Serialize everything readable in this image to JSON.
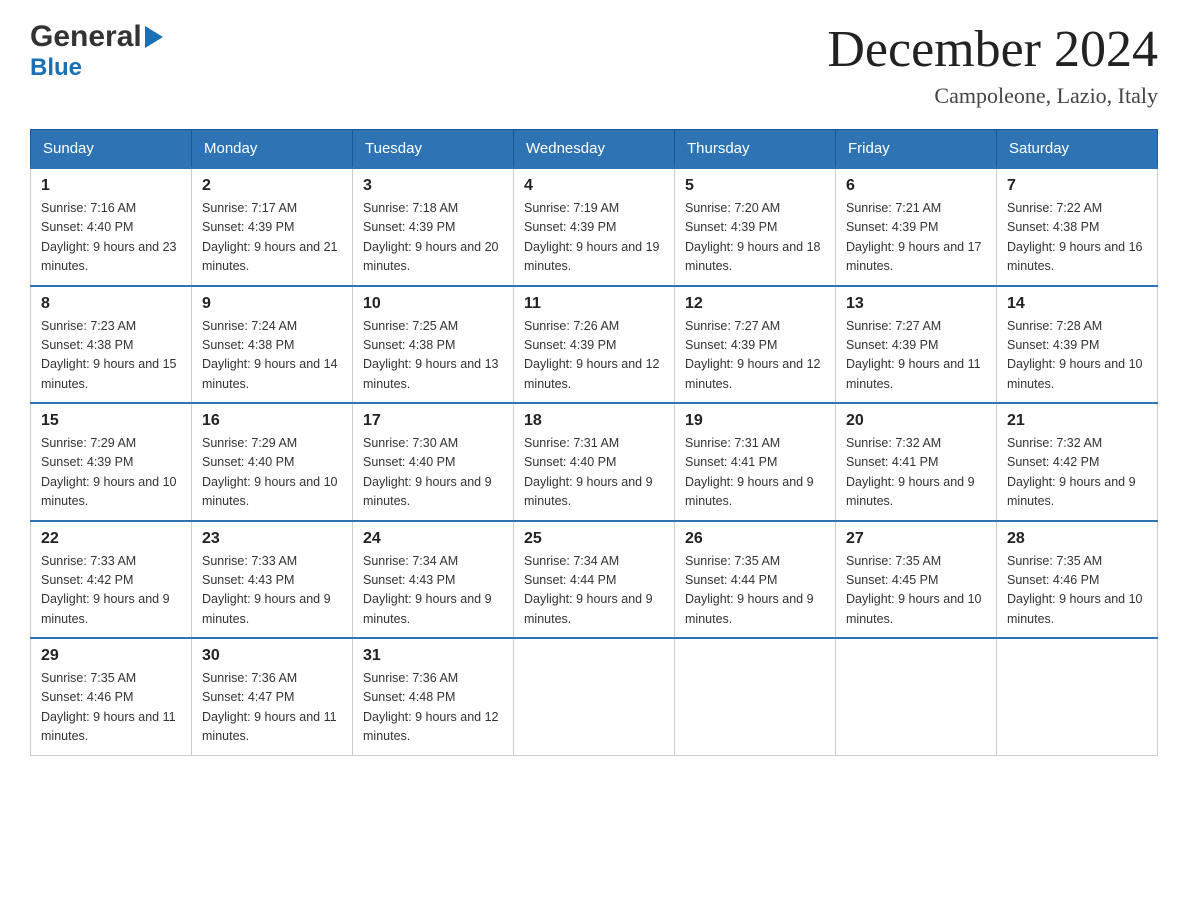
{
  "header": {
    "logo": {
      "general_text": "General",
      "blue_text": "Blue"
    },
    "title": "December 2024",
    "location": "Campoleone, Lazio, Italy"
  },
  "columns": [
    "Sunday",
    "Monday",
    "Tuesday",
    "Wednesday",
    "Thursday",
    "Friday",
    "Saturday"
  ],
  "weeks": [
    [
      {
        "day": "1",
        "sunrise": "Sunrise: 7:16 AM",
        "sunset": "Sunset: 4:40 PM",
        "daylight": "Daylight: 9 hours and 23 minutes."
      },
      {
        "day": "2",
        "sunrise": "Sunrise: 7:17 AM",
        "sunset": "Sunset: 4:39 PM",
        "daylight": "Daylight: 9 hours and 21 minutes."
      },
      {
        "day": "3",
        "sunrise": "Sunrise: 7:18 AM",
        "sunset": "Sunset: 4:39 PM",
        "daylight": "Daylight: 9 hours and 20 minutes."
      },
      {
        "day": "4",
        "sunrise": "Sunrise: 7:19 AM",
        "sunset": "Sunset: 4:39 PM",
        "daylight": "Daylight: 9 hours and 19 minutes."
      },
      {
        "day": "5",
        "sunrise": "Sunrise: 7:20 AM",
        "sunset": "Sunset: 4:39 PM",
        "daylight": "Daylight: 9 hours and 18 minutes."
      },
      {
        "day": "6",
        "sunrise": "Sunrise: 7:21 AM",
        "sunset": "Sunset: 4:39 PM",
        "daylight": "Daylight: 9 hours and 17 minutes."
      },
      {
        "day": "7",
        "sunrise": "Sunrise: 7:22 AM",
        "sunset": "Sunset: 4:38 PM",
        "daylight": "Daylight: 9 hours and 16 minutes."
      }
    ],
    [
      {
        "day": "8",
        "sunrise": "Sunrise: 7:23 AM",
        "sunset": "Sunset: 4:38 PM",
        "daylight": "Daylight: 9 hours and 15 minutes."
      },
      {
        "day": "9",
        "sunrise": "Sunrise: 7:24 AM",
        "sunset": "Sunset: 4:38 PM",
        "daylight": "Daylight: 9 hours and 14 minutes."
      },
      {
        "day": "10",
        "sunrise": "Sunrise: 7:25 AM",
        "sunset": "Sunset: 4:38 PM",
        "daylight": "Daylight: 9 hours and 13 minutes."
      },
      {
        "day": "11",
        "sunrise": "Sunrise: 7:26 AM",
        "sunset": "Sunset: 4:39 PM",
        "daylight": "Daylight: 9 hours and 12 minutes."
      },
      {
        "day": "12",
        "sunrise": "Sunrise: 7:27 AM",
        "sunset": "Sunset: 4:39 PM",
        "daylight": "Daylight: 9 hours and 12 minutes."
      },
      {
        "day": "13",
        "sunrise": "Sunrise: 7:27 AM",
        "sunset": "Sunset: 4:39 PM",
        "daylight": "Daylight: 9 hours and 11 minutes."
      },
      {
        "day": "14",
        "sunrise": "Sunrise: 7:28 AM",
        "sunset": "Sunset: 4:39 PM",
        "daylight": "Daylight: 9 hours and 10 minutes."
      }
    ],
    [
      {
        "day": "15",
        "sunrise": "Sunrise: 7:29 AM",
        "sunset": "Sunset: 4:39 PM",
        "daylight": "Daylight: 9 hours and 10 minutes."
      },
      {
        "day": "16",
        "sunrise": "Sunrise: 7:29 AM",
        "sunset": "Sunset: 4:40 PM",
        "daylight": "Daylight: 9 hours and 10 minutes."
      },
      {
        "day": "17",
        "sunrise": "Sunrise: 7:30 AM",
        "sunset": "Sunset: 4:40 PM",
        "daylight": "Daylight: 9 hours and 9 minutes."
      },
      {
        "day": "18",
        "sunrise": "Sunrise: 7:31 AM",
        "sunset": "Sunset: 4:40 PM",
        "daylight": "Daylight: 9 hours and 9 minutes."
      },
      {
        "day": "19",
        "sunrise": "Sunrise: 7:31 AM",
        "sunset": "Sunset: 4:41 PM",
        "daylight": "Daylight: 9 hours and 9 minutes."
      },
      {
        "day": "20",
        "sunrise": "Sunrise: 7:32 AM",
        "sunset": "Sunset: 4:41 PM",
        "daylight": "Daylight: 9 hours and 9 minutes."
      },
      {
        "day": "21",
        "sunrise": "Sunrise: 7:32 AM",
        "sunset": "Sunset: 4:42 PM",
        "daylight": "Daylight: 9 hours and 9 minutes."
      }
    ],
    [
      {
        "day": "22",
        "sunrise": "Sunrise: 7:33 AM",
        "sunset": "Sunset: 4:42 PM",
        "daylight": "Daylight: 9 hours and 9 minutes."
      },
      {
        "day": "23",
        "sunrise": "Sunrise: 7:33 AM",
        "sunset": "Sunset: 4:43 PM",
        "daylight": "Daylight: 9 hours and 9 minutes."
      },
      {
        "day": "24",
        "sunrise": "Sunrise: 7:34 AM",
        "sunset": "Sunset: 4:43 PM",
        "daylight": "Daylight: 9 hours and 9 minutes."
      },
      {
        "day": "25",
        "sunrise": "Sunrise: 7:34 AM",
        "sunset": "Sunset: 4:44 PM",
        "daylight": "Daylight: 9 hours and 9 minutes."
      },
      {
        "day": "26",
        "sunrise": "Sunrise: 7:35 AM",
        "sunset": "Sunset: 4:44 PM",
        "daylight": "Daylight: 9 hours and 9 minutes."
      },
      {
        "day": "27",
        "sunrise": "Sunrise: 7:35 AM",
        "sunset": "Sunset: 4:45 PM",
        "daylight": "Daylight: 9 hours and 10 minutes."
      },
      {
        "day": "28",
        "sunrise": "Sunrise: 7:35 AM",
        "sunset": "Sunset: 4:46 PM",
        "daylight": "Daylight: 9 hours and 10 minutes."
      }
    ],
    [
      {
        "day": "29",
        "sunrise": "Sunrise: 7:35 AM",
        "sunset": "Sunset: 4:46 PM",
        "daylight": "Daylight: 9 hours and 11 minutes."
      },
      {
        "day": "30",
        "sunrise": "Sunrise: 7:36 AM",
        "sunset": "Sunset: 4:47 PM",
        "daylight": "Daylight: 9 hours and 11 minutes."
      },
      {
        "day": "31",
        "sunrise": "Sunrise: 7:36 AM",
        "sunset": "Sunset: 4:48 PM",
        "daylight": "Daylight: 9 hours and 12 minutes."
      },
      null,
      null,
      null,
      null
    ]
  ]
}
